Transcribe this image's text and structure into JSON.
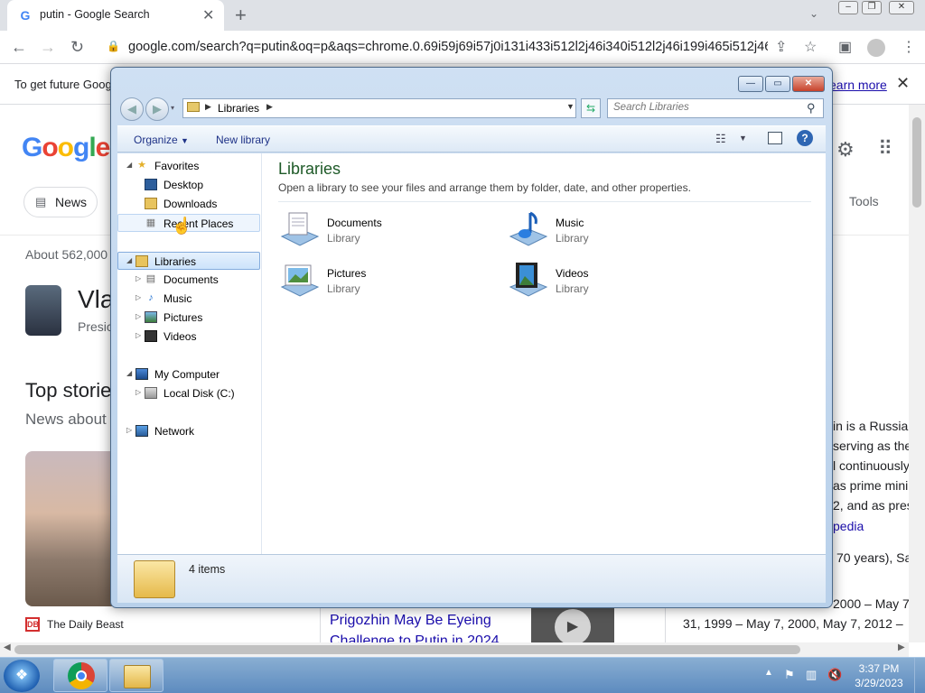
{
  "browser": {
    "tab_title": "putin - Google Search",
    "tab_favicon": "G",
    "url": "google.com/search?q=putin&oq=p&aqs=chrome.0.69i59j69i57j0i131i433i512l2j46i340i512l2j46i199i465i512j46i..."
  },
  "google": {
    "banner_text": "To get future Goog",
    "banner_link": "earn more",
    "logo": "Google",
    "news_chip": "News",
    "tools": "Tools",
    "about": "About 562,000",
    "knowledge_name": "Vla",
    "knowledge_sub": "Presic",
    "top_stories": "Top storie",
    "news_about": "News about",
    "source": "The Daily Beast",
    "story_title": "Prigozhin May Be Eyeing Challenge to Putin in 2024",
    "kp_lines": [
      "in is a Russian",
      "serving as the",
      "l continuously",
      "as prime mini",
      "2, and as pres"
    ],
    "wiki": "pedia",
    "born": "70 years), Sa",
    "dates_line1": "2000 – May 7",
    "dates_line2": "31, 1999 – May 7, 2000, May 7, 2012 –"
  },
  "explorer": {
    "address_root": "Libraries",
    "search_placeholder": "Search Libraries",
    "organize": "Organize",
    "new_library": "New library",
    "nav": {
      "favorites": "Favorites",
      "desktop": "Desktop",
      "downloads": "Downloads",
      "recent_places": "Recent Places",
      "libraries": "Libraries",
      "documents": "Documents",
      "music": "Music",
      "pictures": "Pictures",
      "videos": "Videos",
      "my_computer": "My Computer",
      "local_disk": "Local Disk (C:)",
      "network": "Network"
    },
    "content_title": "Libraries",
    "content_desc": "Open a library to see your files and arrange them by folder, date, and other properties.",
    "libraries": [
      {
        "name": "Documents",
        "type": "Library",
        "icon": "documents-icon"
      },
      {
        "name": "Music",
        "type": "Library",
        "icon": "music-icon"
      },
      {
        "name": "Pictures",
        "type": "Library",
        "icon": "pictures-icon"
      },
      {
        "name": "Videos",
        "type": "Library",
        "icon": "videos-icon"
      }
    ],
    "status": "4 items"
  },
  "taskbar": {
    "time": "3:37 PM",
    "date": "3/29/2023"
  },
  "colors": {
    "accent": "#1a0dab",
    "library_title": "#1e5a28",
    "taskbar": "#5d8bbf"
  }
}
